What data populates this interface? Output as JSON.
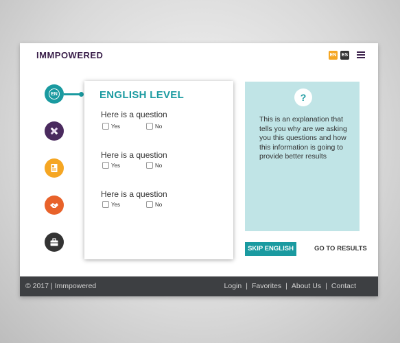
{
  "header": {
    "logo": "IMMPOWERED",
    "lang_en": "EN",
    "lang_es": "ES"
  },
  "steps": [
    {
      "label": "EN",
      "icon": "language-icon",
      "color": "#1a9aa0"
    },
    {
      "icon": "pencil-ruler-icon",
      "color": "#4a2a5e"
    },
    {
      "icon": "document-icon",
      "color": "#f5a623"
    },
    {
      "icon": "handshake-icon",
      "color": "#e8622a"
    },
    {
      "icon": "briefcase-icon",
      "color": "#333333"
    }
  ],
  "card": {
    "title": "ENGLISH LEVEL",
    "questions": [
      {
        "text": "Here is a question",
        "yes": "Yes",
        "no": "No"
      },
      {
        "text": "Here is a question",
        "yes": "Yes",
        "no": "No"
      },
      {
        "text": "Here is a question",
        "yes": "Yes",
        "no": "No"
      }
    ]
  },
  "panel": {
    "icon": "question-icon",
    "mark": "?",
    "text": "This is an explanation that tells you why are we asking you this questions and how this information is going to provide better results"
  },
  "actions": {
    "skip": "SKIP ENGLISH",
    "results": "GO TO RESULTS"
  },
  "footer": {
    "copyright": "© 2017 | Immpowered",
    "links": [
      "Login",
      "Favorites",
      "About Us",
      "Contact"
    ],
    "separator": "|"
  },
  "colors": {
    "accent": "#1a9aa0",
    "brand": "#3a1f4a",
    "panel_bg": "#c0e4e6",
    "footer_bg": "#3d3f42"
  }
}
